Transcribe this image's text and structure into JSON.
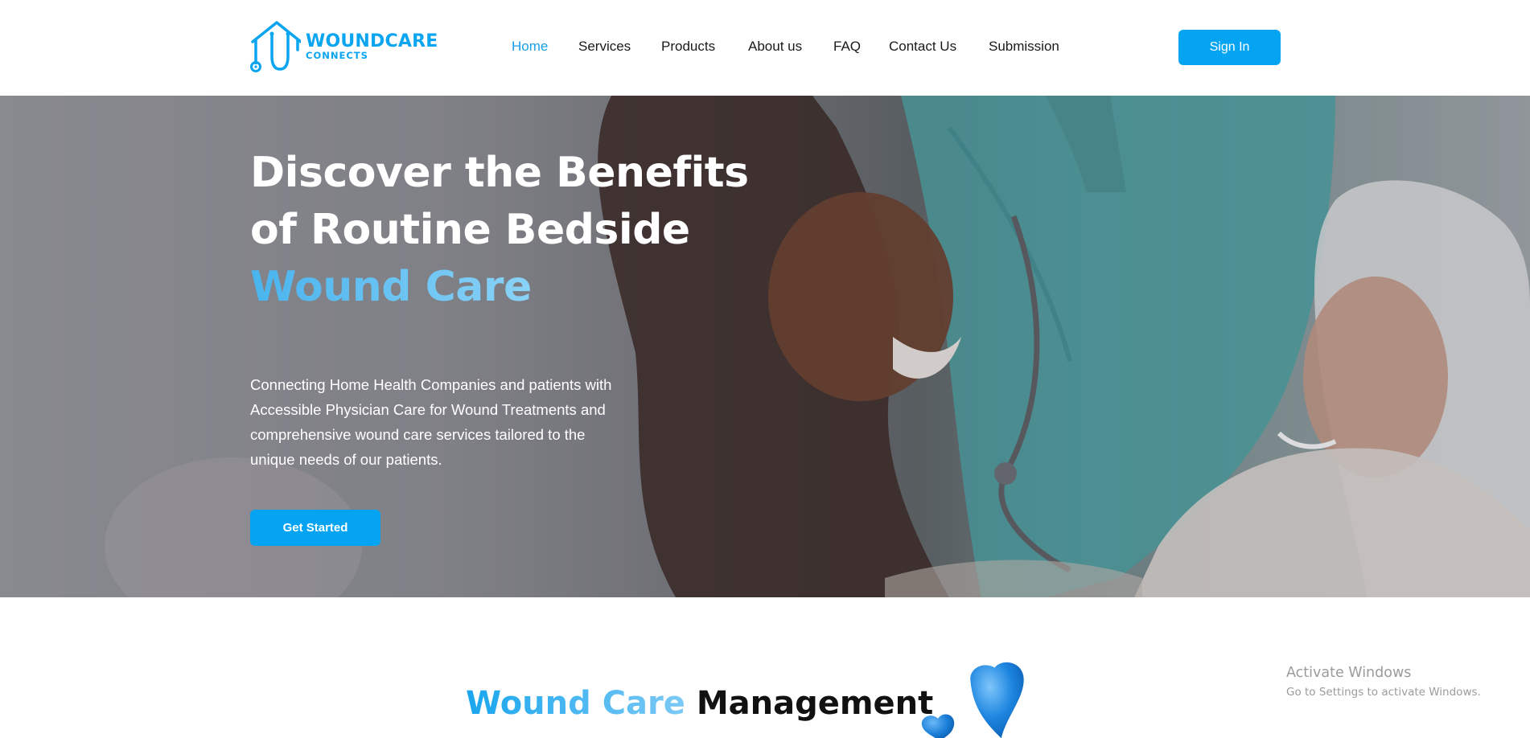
{
  "brand": {
    "name": "WOUNDCARE",
    "tagline": "CONNECTS",
    "color": "#0aa5f0"
  },
  "nav": {
    "items": [
      {
        "label": "Home",
        "active": true
      },
      {
        "label": "Services",
        "active": false
      },
      {
        "label": "Products",
        "active": false
      },
      {
        "label": "About us",
        "active": false
      },
      {
        "label": "FAQ",
        "active": false
      },
      {
        "label": "Contact Us",
        "active": false
      },
      {
        "label": "Submission",
        "active": false
      }
    ],
    "active_color": "#1c9fea"
  },
  "header": {
    "signin_label": "Sign In"
  },
  "hero": {
    "title_plain": "Discover the Benefits of Routine Bedside ",
    "title_highlight": "Wound Care",
    "description": "Connecting Home Health Companies and patients with Accessible Physician Care for Wound Treatments and comprehensive wound care services tailored to the unique needs of our patients.",
    "cta_label": "Get Started"
  },
  "section": {
    "title_highlight": "Wound Care",
    "title_plain": " Management"
  },
  "watermark": {
    "line1": "Activate Windows",
    "line2": "Go to Settings to activate Windows."
  },
  "colors": {
    "accent": "#04a4f2",
    "highlight_start": "#49b4ee",
    "highlight_end": "#8ad2f7"
  }
}
